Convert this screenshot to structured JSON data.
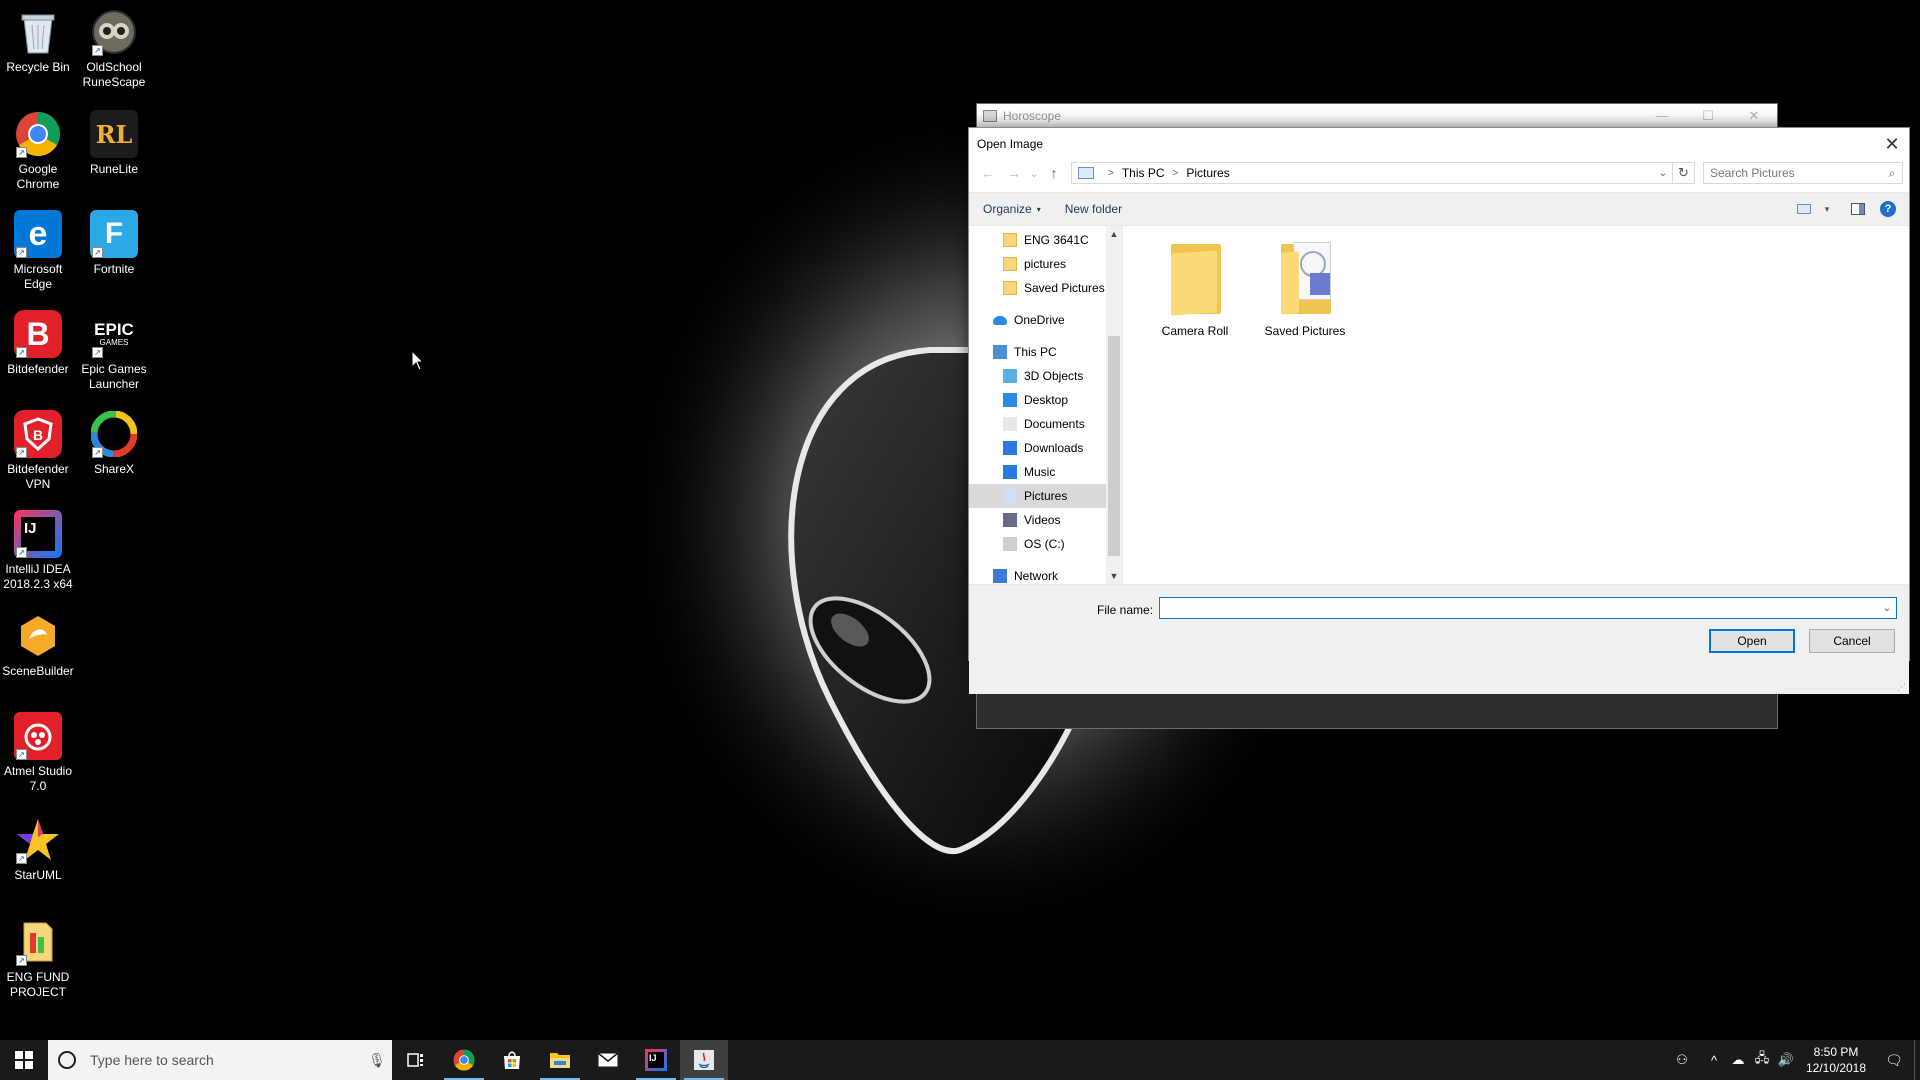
{
  "colors": {
    "accent": "#0078d7",
    "taskbar": "#1a1a1a",
    "desktop": "#000000",
    "horoscope_body": "#2d2d30"
  },
  "desktop_icons": [
    {
      "label": "Recycle Bin",
      "icon": "recycle-bin-icon"
    },
    {
      "label": "OldSchool RuneScape",
      "icon": "runescape-icon"
    },
    {
      "label": "Google Chrome",
      "icon": "chrome-icon"
    },
    {
      "label": "RuneLite",
      "icon": "runelite-icon"
    },
    {
      "label": "Microsoft Edge",
      "icon": "edge-icon"
    },
    {
      "label": "Fortnite",
      "icon": "fortnite-icon"
    },
    {
      "label": "Bitdefender",
      "icon": "bitdefender-icon"
    },
    {
      "label": "Epic Games Launcher",
      "icon": "epic-games-icon"
    },
    {
      "label": "Bitdefender VPN",
      "icon": "bitdefender-vpn-icon"
    },
    {
      "label": "ShareX",
      "icon": "sharex-icon"
    },
    {
      "label": "IntelliJ IDEA 2018.2.3 x64",
      "icon": "intellij-icon"
    },
    {
      "label": "SceneBuilder",
      "icon": "scenebuilder-icon"
    },
    {
      "label": "Atmel Studio 7.0",
      "icon": "atmel-studio-icon"
    },
    {
      "label": "StarUML",
      "icon": "staruml-icon"
    },
    {
      "label": "ENG FUND PROJECT",
      "icon": "project-file-icon"
    }
  ],
  "icon_glyphs": {
    "runelite": "RL",
    "edge": "e",
    "fortnite": "F",
    "bitdefender": "B",
    "epic": "EPIC",
    "epic_sub": "GAMES",
    "intellij": "IJ",
    "shortcut": "↗"
  },
  "horoscope_window": {
    "title": "Horoscope",
    "minimize": "—",
    "maximize": "☐",
    "close": "✕"
  },
  "dialog": {
    "title": "Open Image",
    "close": "✕",
    "nav": {
      "back": "←",
      "forward": "→",
      "recent": "⌄",
      "up": "↑"
    },
    "address": {
      "root": "This PC",
      "current": "Pictures",
      "separator": ">",
      "dropdown": "⌄",
      "refresh": "↻"
    },
    "search": {
      "placeholder": "Search Pictures",
      "icon": "⌕"
    },
    "toolbar": {
      "organize": "Organize",
      "organize_caret": "▾",
      "new_folder": "New folder",
      "view_caret": "▾",
      "help": "?"
    },
    "nav_pane": {
      "scroll_up": "▲",
      "scroll_down": "▼",
      "items": [
        {
          "label": "ENG 3641C",
          "icon": "folder-icon",
          "level": 1
        },
        {
          "label": "pictures",
          "icon": "folder-icon",
          "level": 1
        },
        {
          "label": "Saved Pictures",
          "icon": "folder-icon",
          "level": 1
        },
        {
          "label": "OneDrive",
          "icon": "onedrive-icon",
          "level": 0
        },
        {
          "label": "This PC",
          "icon": "this-pc-icon",
          "level": 0
        },
        {
          "label": "3D Objects",
          "icon": "3d-objects-icon",
          "level": 1
        },
        {
          "label": "Desktop",
          "icon": "desktop-folder-icon",
          "level": 1
        },
        {
          "label": "Documents",
          "icon": "documents-icon",
          "level": 1
        },
        {
          "label": "Downloads",
          "icon": "downloads-icon",
          "level": 1
        },
        {
          "label": "Music",
          "icon": "music-icon",
          "level": 1
        },
        {
          "label": "Pictures",
          "icon": "pictures-icon",
          "level": 1,
          "selected": true
        },
        {
          "label": "Videos",
          "icon": "videos-icon",
          "level": 1
        },
        {
          "label": "OS (C:)",
          "icon": "drive-icon",
          "level": 1
        },
        {
          "label": "Network",
          "icon": "network-icon",
          "level": 0
        }
      ]
    },
    "files": [
      {
        "name": "Camera Roll",
        "icon": "folder-icon"
      },
      {
        "name": "Saved Pictures",
        "icon": "folder-with-content-icon"
      }
    ],
    "footer": {
      "file_name_label": "File name:",
      "file_name_value": "",
      "dropdown": "⌄",
      "open": "Open",
      "cancel": "Cancel",
      "grip": "⋰"
    }
  },
  "taskbar": {
    "search_placeholder": "Type here to search",
    "mic": "🎙",
    "apps": [
      {
        "name": "task-view",
        "icon": "task-view-icon"
      },
      {
        "name": "chrome",
        "icon": "chrome-icon",
        "running": true
      },
      {
        "name": "microsoft-store",
        "icon": "store-icon"
      },
      {
        "name": "file-explorer",
        "icon": "file-explorer-icon",
        "running": true
      },
      {
        "name": "mail",
        "icon": "mail-icon"
      },
      {
        "name": "intellij",
        "icon": "intellij-icon",
        "running": true
      },
      {
        "name": "java",
        "icon": "java-icon",
        "running": true,
        "active": true
      }
    ],
    "tray": {
      "people": "⚇",
      "chevron": "^",
      "onedrive": "☁",
      "network": "🖧",
      "volume": "🔊",
      "notifications": "🗨"
    },
    "time": "8:50 PM",
    "date": "12/10/2018"
  }
}
